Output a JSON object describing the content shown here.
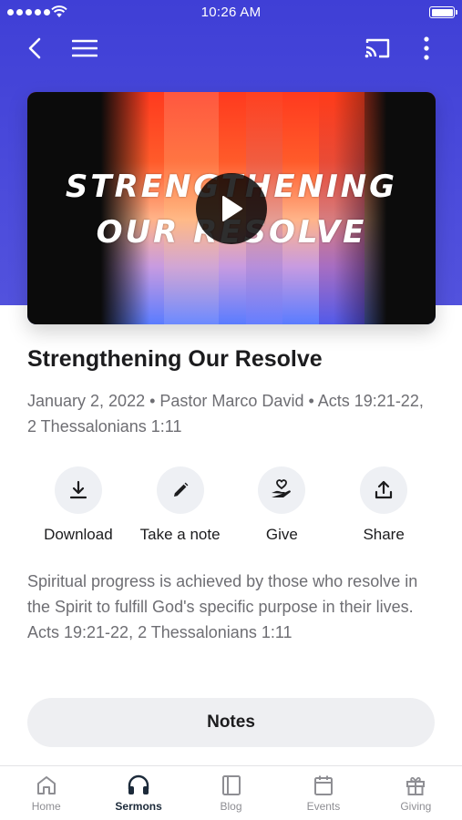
{
  "status_bar": {
    "time": "10:26 AM"
  },
  "video": {
    "title_line1": "STRENGTHENING",
    "title_line2": "OUR RESOLVE"
  },
  "sermon": {
    "title": "Strengthening Our Resolve",
    "meta": "January 2, 2022 • Pastor Marco David • Acts 19:21-22, 2 Thessalonians 1:11",
    "description": "Spiritual progress is achieved by those who resolve in the Spirit to fulfill God's specific purpose in their lives. Acts 19:21-22, 2 Thessalonians 1:11"
  },
  "actions": [
    {
      "label": "Download",
      "icon": "download-icon"
    },
    {
      "label": "Take a note",
      "icon": "pencil-icon"
    },
    {
      "label": "Give",
      "icon": "hand-heart-icon"
    },
    {
      "label": "Share",
      "icon": "share-icon"
    }
  ],
  "notes_button": {
    "label": "Notes"
  },
  "tabs": [
    {
      "label": "Home",
      "icon": "home-icon",
      "active": false
    },
    {
      "label": "Sermons",
      "icon": "headphones-icon",
      "active": true
    },
    {
      "label": "Blog",
      "icon": "book-icon",
      "active": false
    },
    {
      "label": "Events",
      "icon": "calendar-icon",
      "active": false
    },
    {
      "label": "Giving",
      "icon": "gift-icon",
      "active": false
    }
  ],
  "colors": {
    "header": "#4343d8",
    "text_primary": "#1c1c1e",
    "text_secondary": "#6e6e73",
    "button_bg": "#eef0f4",
    "tab_active": "#1c2a3a",
    "tab_inactive": "#8e8e93"
  }
}
